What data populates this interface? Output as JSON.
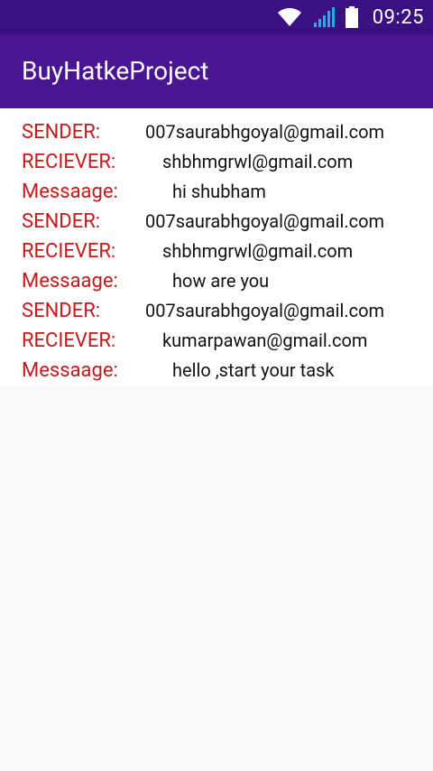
{
  "status_bar": {
    "time": "09:25",
    "icons": [
      "wifi-icon",
      "signal-icon",
      "battery-icon"
    ]
  },
  "app_bar": {
    "title": "BuyHatkeProject"
  },
  "labels": {
    "sender": "SENDER:",
    "receiver": "RECIEVER:",
    "message": "Messaage:"
  },
  "messages": [
    {
      "sender": "007saurabhgoyal@gmail.com",
      "receiver": "shbhmgrwl@gmail.com",
      "message": "hi shubham"
    },
    {
      "sender": "007saurabhgoyal@gmail.com",
      "receiver": "shbhmgrwl@gmail.com",
      "message": "how are you"
    },
    {
      "sender": "007saurabhgoyal@gmail.com",
      "receiver": "kumarpawan@gmail.com",
      "message": "hello ,start your task"
    }
  ],
  "colors": {
    "status_bar": "#3b1080",
    "app_bar": "#4a1591",
    "label": "#c41a1a",
    "value": "#111111",
    "background": "#fafafa"
  }
}
